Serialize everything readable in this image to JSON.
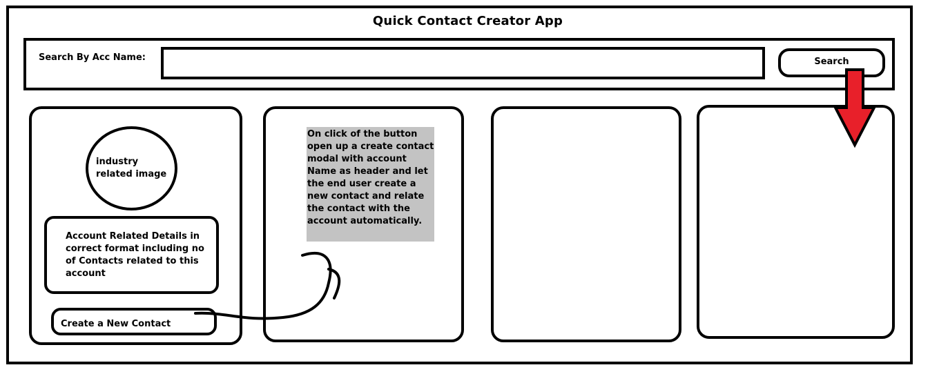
{
  "app": {
    "title": "Quick Contact Creator App"
  },
  "search": {
    "label": "Search By Acc Name:",
    "value": "",
    "placeholder": "",
    "button_label": "Search"
  },
  "account_card": {
    "image_placeholder_text": "industry related image",
    "details_text": "Account Related Details in correct format including no of Contacts related to this account",
    "create_button_label": "Create a New Contact"
  },
  "annotation": {
    "note_text": "On click of the button open up a create contact modal with account Name as header and let the end user create a new contact and relate the contact with the account automatically."
  },
  "colors": {
    "outline": "#000000",
    "note_background": "#c3c3c3",
    "arrow_fill": "#e8202a"
  },
  "icons": {
    "flow_arrow": "red-down-arrow-icon",
    "connector": "curved-connector-line"
  }
}
